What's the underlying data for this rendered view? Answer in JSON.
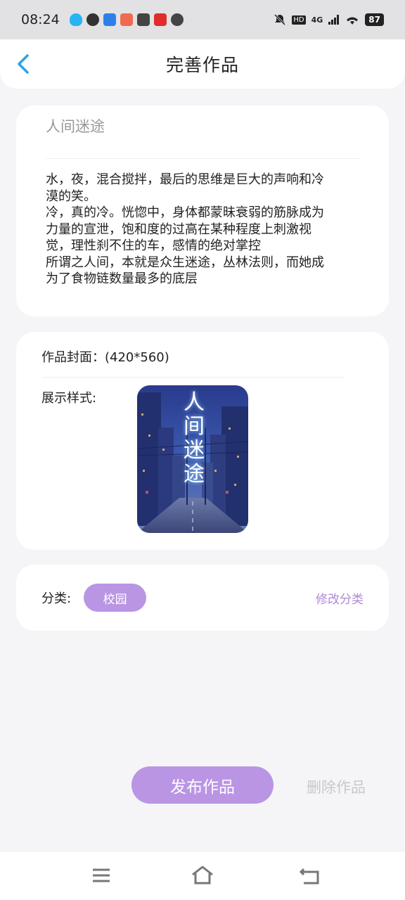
{
  "status": {
    "time": "08:24",
    "network": "4G",
    "battery": "87"
  },
  "header": {
    "title": "完善作品"
  },
  "work": {
    "title": "人间迷途",
    "body": "水，夜，混合搅拌，最后的思维是巨大的声响和冷\n漠的笑。\n冷，真的冷。恍惚中，身体都蒙昧衰弱的筋脉成为\n力量的宣泄，饱和度的过高在某种程度上刺激视\n觉，理性刹不住的车，感情的绝对掌控\n所谓之人间，本就是众生迷途，丛林法则，而她成\n为了食物链数量最多的底层"
  },
  "cover": {
    "label": "作品封面：(420*560)",
    "style_label": "展示样式:",
    "image_text": "人间迷途"
  },
  "category": {
    "label": "分类:",
    "value": "校园",
    "edit_label": "修改分类"
  },
  "actions": {
    "publish_label": "发布作品",
    "delete_label": "删除作品"
  },
  "colors": {
    "accent": "#b995e4",
    "accent_text": "#b087d8",
    "back_arrow": "#2aa3e6"
  }
}
